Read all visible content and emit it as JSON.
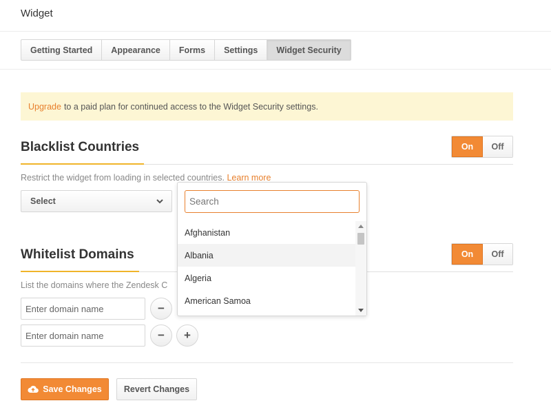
{
  "header": {
    "title": "Widget"
  },
  "tabs": [
    {
      "label": "Getting Started",
      "active": false
    },
    {
      "label": "Appearance",
      "active": false
    },
    {
      "label": "Forms",
      "active": false
    },
    {
      "label": "Settings",
      "active": false
    },
    {
      "label": "Widget Security",
      "active": true
    }
  ],
  "notice": {
    "link": "Upgrade",
    "text": "to a paid plan for continued access to the Widget Security settings.",
    "background": "#fdf6d4"
  },
  "blacklist": {
    "title": "Blacklist Countries",
    "toggle": {
      "on": "On",
      "off": "Off",
      "selected": "On"
    },
    "description": "Restrict the widget from loading in selected countries.",
    "learn_more": "Learn more",
    "select_label": "Select"
  },
  "dropdown": {
    "search_placeholder": "Search",
    "items": [
      "Afghanistan",
      "Albania",
      "Algeria",
      "American Samoa"
    ],
    "hovered": "Albania"
  },
  "whitelist": {
    "title": "Whitelist Domains",
    "toggle": {
      "on": "On",
      "off": "Off",
      "selected": "On"
    },
    "description": "List the domains where the Zendesk C",
    "domain_placeholder": "Enter domain name",
    "remove_symbol": "−",
    "add_symbol": "+"
  },
  "actions": {
    "save": "Save Changes",
    "save_icon": "cloud-upload-icon",
    "revert": "Revert Changes"
  },
  "colors": {
    "accent": "#f28a35",
    "link": "#e8802d",
    "section_underline": "#f0b429"
  }
}
